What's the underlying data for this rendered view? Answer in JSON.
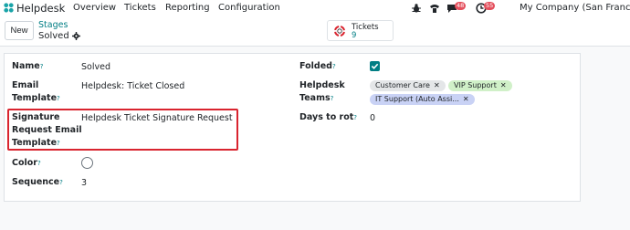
{
  "topbar": {
    "app_name": "Helpdesk",
    "menu": [
      "Overview",
      "Tickets",
      "Reporting",
      "Configuration"
    ],
    "chat_badge": "48",
    "activity_badge": "55",
    "company": "My Company (San Francisco"
  },
  "control": {
    "new_label": "New",
    "breadcrumb": "Stages",
    "record_name": "Solved",
    "smart_button": {
      "label": "Tickets",
      "count": "9"
    }
  },
  "form": {
    "name_label": "Name",
    "name_value": "Solved",
    "email_template_label_1": "Email",
    "email_template_label_2": "Template",
    "email_template_value": "Helpdesk: Ticket Closed",
    "signature_label_1": "Signature",
    "signature_label_2": "Request Email",
    "signature_label_3": "Template",
    "signature_value": "Helpdesk Ticket Signature Request",
    "color_label": "Color",
    "sequence_label": "Sequence",
    "sequence_value": "3",
    "folded_label": "Folded",
    "teams_label_1": "Helpdesk",
    "teams_label_2": "Teams",
    "teams": [
      {
        "name": "Customer Care",
        "color": "#e4e6e8"
      },
      {
        "name": "VIP Support",
        "color": "#d0f0c8"
      },
      {
        "name": "IT Support (Auto Assi...",
        "color": "#c9d2f5"
      }
    ],
    "days_to_rot_label": "Days to rot",
    "days_to_rot_value": "0",
    "help_mark": "?",
    "remove_mark": "✕"
  },
  "colors": {
    "accent": "#017e84",
    "highlight": "#d9242f",
    "badge": "#e4505d"
  },
  "icons": [
    "helpdesk-app-icon",
    "bug-icon",
    "phone-icon",
    "chat-icon",
    "clock-icon",
    "gear-icon",
    "lifebuoy-icon",
    "checkmark-icon"
  ]
}
